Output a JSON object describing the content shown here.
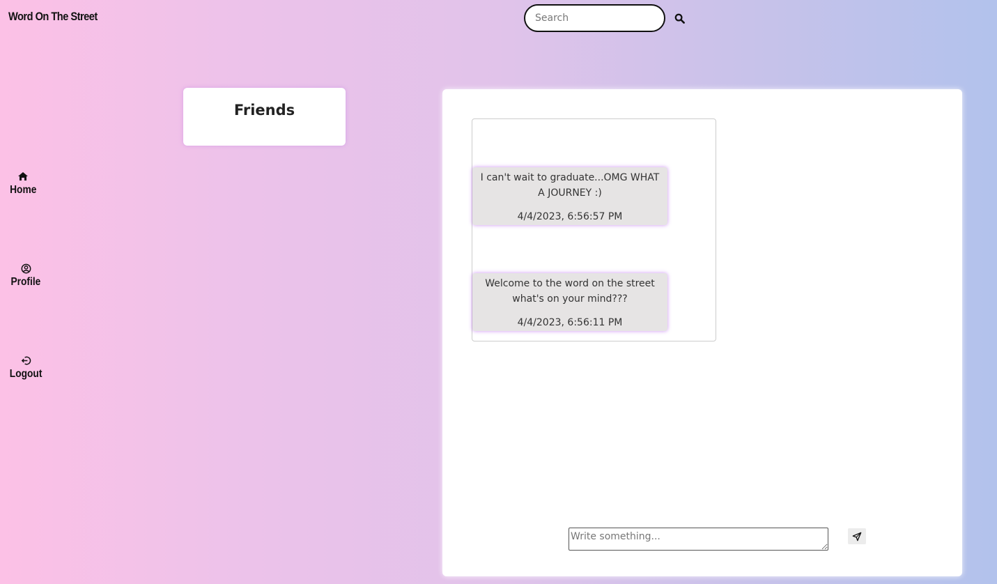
{
  "header": {
    "brand": "Word On The Street",
    "search": {
      "placeholder": "Search",
      "value": "",
      "icon": "search-icon"
    }
  },
  "sidebar": {
    "items": [
      {
        "label": "Home",
        "icon": "home-icon"
      },
      {
        "label": "Profile",
        "icon": "user-circle-icon"
      },
      {
        "label": "Logout",
        "icon": "logout-icon"
      }
    ]
  },
  "friends": {
    "title": "Friends"
  },
  "feed": {
    "posts": [
      {
        "text": "I can't wait to graduate...OMG WHAT A JOURNEY :)",
        "timestamp": "4/4/2023, 6:56:57 PM"
      },
      {
        "text": "Welcome to the word on the street what's on your mind???",
        "timestamp": "4/4/2023, 6:56:11 PM"
      }
    ]
  },
  "composer": {
    "placeholder": "Write something...",
    "value": "",
    "send_icon": "send-icon"
  },
  "colors": {
    "gradient_start": "#fcc1e6",
    "gradient_end": "#b2c2ec",
    "post_background": "#e6e4e4",
    "post_glow": "#be6ef0"
  }
}
